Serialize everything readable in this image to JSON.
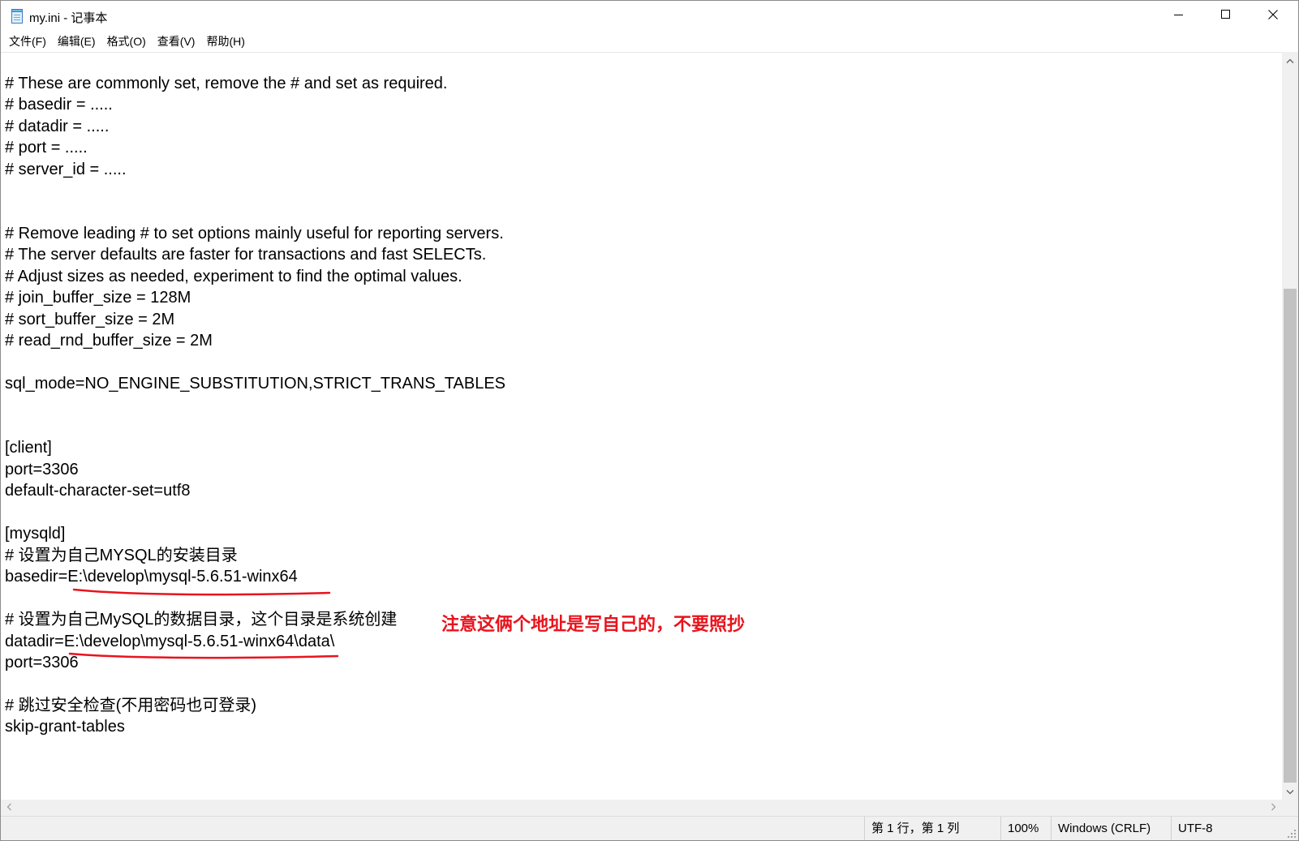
{
  "window": {
    "title": "my.ini - 记事本",
    "icon": "notepad-icon",
    "controls": {
      "minimize": "minimize-icon",
      "maximize": "maximize-icon",
      "close": "close-icon"
    }
  },
  "menu": [
    {
      "label": "文件(F)"
    },
    {
      "label": "编辑(E)"
    },
    {
      "label": "格式(O)"
    },
    {
      "label": "查看(V)"
    },
    {
      "label": "帮助(H)"
    }
  ],
  "editor": {
    "lines": [
      "# These are commonly set, remove the # and set as required.",
      "# basedir = .....",
      "# datadir = .....",
      "# port = .....",
      "# server_id = .....",
      "# Remove leading # to set options mainly useful for reporting servers.",
      "# The server defaults are faster for transactions and fast SELECTs.",
      "# Adjust sizes as needed, experiment to find the optimal values.",
      "# join_buffer_size = 128M",
      "# sort_buffer_size = 2M",
      "# read_rnd_buffer_size = 2M",
      "sql_mode=NO_ENGINE_SUBSTITUTION,STRICT_TRANS_TABLES",
      "[client]",
      "port=3306",
      "default-character-set=utf8",
      "[mysqld]",
      "# 设置为自己MYSQL的安装目录",
      "basedir=E:\\develop\\mysql-5.6.51-winx64",
      "# 设置为自己MySQL的数据目录，这个目录是系统创建",
      "datadir=E:\\develop\\mysql-5.6.51-winx64\\data\\",
      "port=3306",
      "# 跳过安全检查(不用密码也可登录)",
      "skip-grant-tables"
    ],
    "annotation": "注意这俩个地址是写自己的，不要照抄",
    "annotation_color": "#e8141d"
  },
  "scrollbars": {
    "vertical_icons": [
      "chevron-up-icon",
      "chevron-down-icon"
    ],
    "horizontal_icons": [
      "chevron-left-icon",
      "chevron-right-icon"
    ]
  },
  "statusbar": {
    "position": "第 1 行，第 1 列",
    "zoom": "100%",
    "line_ending": "Windows (CRLF)",
    "encoding": "UTF-8"
  }
}
